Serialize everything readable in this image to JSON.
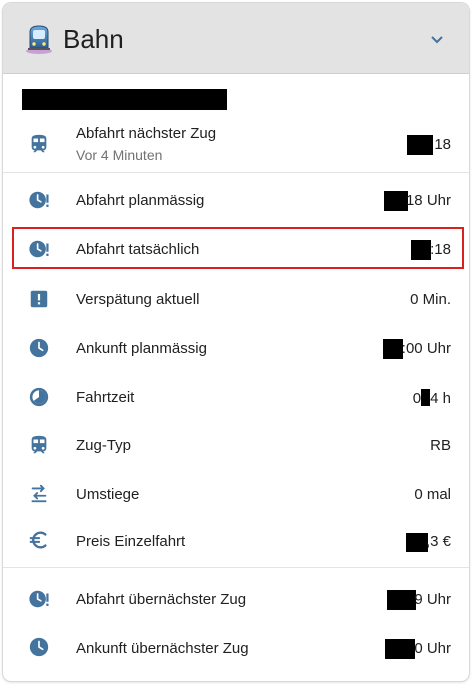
{
  "card": {
    "title": "Bahn",
    "accent_color": "#44739e",
    "highlight_color": "#d9211f"
  },
  "rows": [
    {
      "label": "Abfahrt nächster Zug",
      "sub": "Vor 4 Minuten",
      "value": "18",
      "icon": "train-icon"
    },
    {
      "label": "Abfahrt planmässig",
      "value": "18 Uhr",
      "icon": "clock-alert-icon"
    },
    {
      "label": "Abfahrt tatsächlich",
      "value": ":18",
      "icon": "clock-alert-icon"
    },
    {
      "label": "Verspätung aktuell",
      "value": "0 Min.",
      "icon": "alert-box-icon"
    },
    {
      "label": "Ankunft planmässig",
      "value": ":00 Uhr",
      "icon": "clock-icon"
    },
    {
      "label": "Fahrtzeit",
      "value": "0",
      "value_suffix": "4 h",
      "icon": "clock-time-icon"
    },
    {
      "label": "Zug-Typ",
      "value": "RB",
      "icon": "train-icon"
    },
    {
      "label": "Umstiege",
      "value": "0 mal",
      "icon": "swap-icon"
    },
    {
      "label": "Preis Einzelfahrt",
      "value": ",3 €",
      "icon": "euro-icon"
    },
    {
      "label": "Abfahrt übernächster Zug",
      "value": "9 Uhr",
      "icon": "clock-alert-icon"
    },
    {
      "label": "Ankunft übernächster Zug",
      "value": "0 Uhr",
      "icon": "clock-icon"
    }
  ]
}
